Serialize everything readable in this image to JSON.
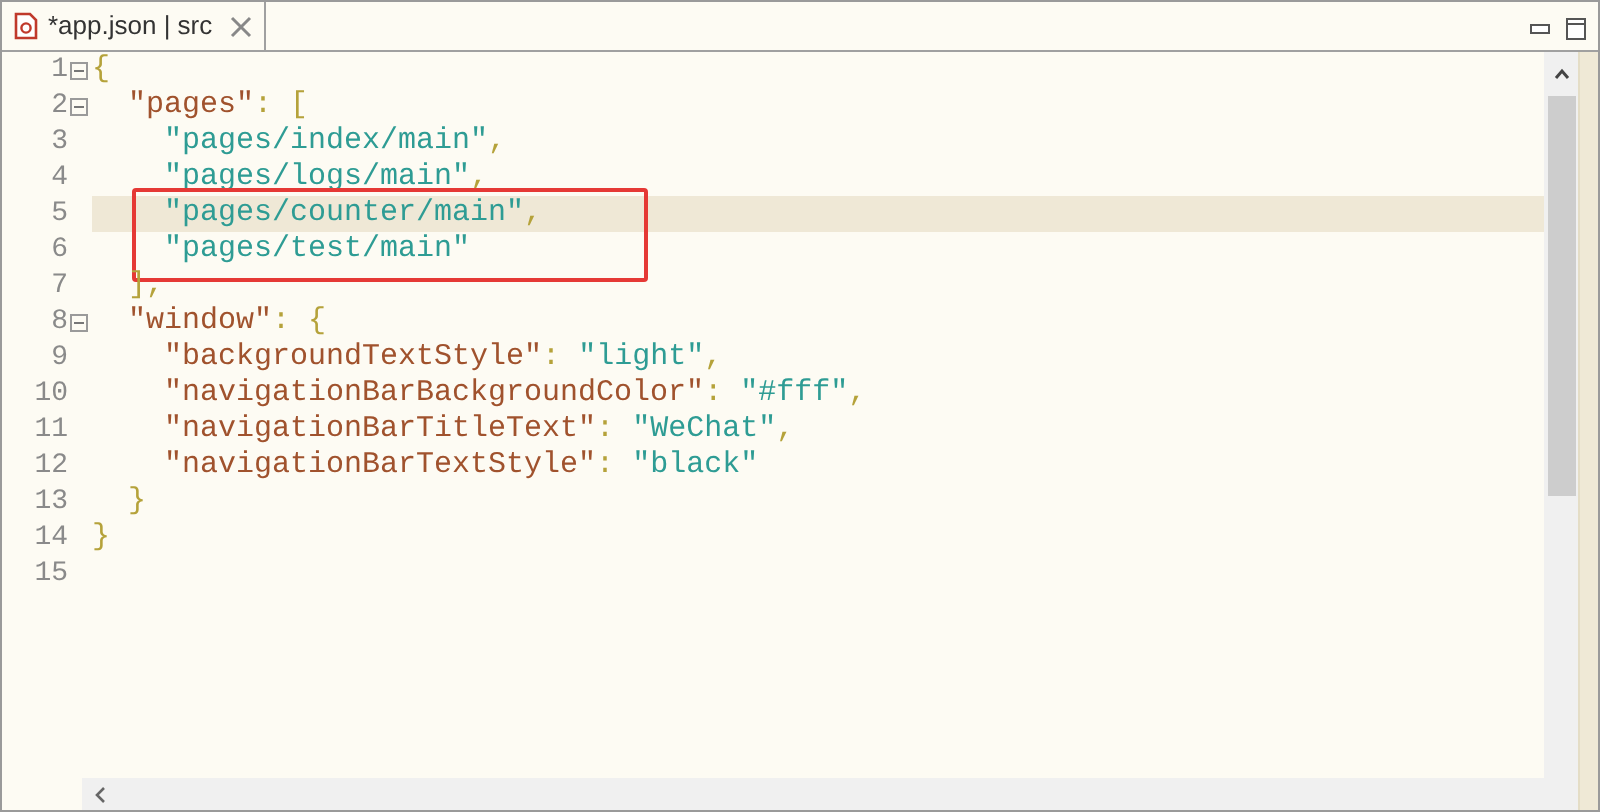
{
  "tab": {
    "title": "*app.json | src",
    "selected": true
  },
  "lines": [
    {
      "number": "1",
      "fold": true,
      "current": false,
      "boxed": false,
      "tokens": [
        {
          "kind": "punct",
          "text": "{"
        }
      ]
    },
    {
      "number": "2",
      "fold": true,
      "current": false,
      "boxed": false,
      "tokens": [
        {
          "kind": "key",
          "text": "  \"pages\""
        },
        {
          "kind": "punct",
          "text": ": ["
        }
      ]
    },
    {
      "number": "3",
      "fold": false,
      "current": false,
      "boxed": false,
      "tokens": [
        {
          "kind": "string",
          "text": "    \"pages/index/main\""
        },
        {
          "kind": "punct",
          "text": ","
        }
      ]
    },
    {
      "number": "4",
      "fold": false,
      "current": false,
      "boxed": false,
      "tokens": [
        {
          "kind": "string",
          "text": "    \"pages/logs/main\""
        },
        {
          "kind": "punct",
          "text": ","
        }
      ]
    },
    {
      "number": "5",
      "fold": false,
      "current": true,
      "boxed": true,
      "tokens": [
        {
          "kind": "string",
          "text": "    \"pages/counter/main\""
        },
        {
          "kind": "punct",
          "text": ","
        }
      ]
    },
    {
      "number": "6",
      "fold": false,
      "current": false,
      "boxed": true,
      "tokens": [
        {
          "kind": "string",
          "text": "    \"pages/test/main\""
        }
      ]
    },
    {
      "number": "7",
      "fold": false,
      "current": false,
      "boxed": false,
      "tokens": [
        {
          "kind": "punct",
          "text": "  ],"
        }
      ]
    },
    {
      "number": "8",
      "fold": true,
      "current": false,
      "boxed": false,
      "tokens": [
        {
          "kind": "key",
          "text": "  \"window\""
        },
        {
          "kind": "punct",
          "text": ": {"
        }
      ]
    },
    {
      "number": "9",
      "fold": false,
      "current": false,
      "boxed": false,
      "tokens": [
        {
          "kind": "key",
          "text": "    \"backgroundTextStyle\""
        },
        {
          "kind": "punct",
          "text": ": "
        },
        {
          "kind": "string",
          "text": "\"light\""
        },
        {
          "kind": "punct",
          "text": ","
        }
      ]
    },
    {
      "number": "10",
      "fold": false,
      "current": false,
      "boxed": false,
      "tokens": [
        {
          "kind": "key",
          "text": "    \"navigationBarBackgroundColor\""
        },
        {
          "kind": "punct",
          "text": ": "
        },
        {
          "kind": "string",
          "text": "\"#fff\""
        },
        {
          "kind": "punct",
          "text": ","
        }
      ]
    },
    {
      "number": "11",
      "fold": false,
      "current": false,
      "boxed": false,
      "tokens": [
        {
          "kind": "key",
          "text": "    \"navigationBarTitleText\""
        },
        {
          "kind": "punct",
          "text": ": "
        },
        {
          "kind": "string",
          "text": "\"WeChat\""
        },
        {
          "kind": "punct",
          "text": ","
        }
      ]
    },
    {
      "number": "12",
      "fold": false,
      "current": false,
      "boxed": false,
      "tokens": [
        {
          "kind": "key",
          "text": "    \"navigationBarTextStyle\""
        },
        {
          "kind": "punct",
          "text": ": "
        },
        {
          "kind": "string",
          "text": "\"black\""
        }
      ]
    },
    {
      "number": "13",
      "fold": false,
      "current": false,
      "boxed": false,
      "tokens": [
        {
          "kind": "punct",
          "text": "  }"
        }
      ]
    },
    {
      "number": "14",
      "fold": false,
      "current": false,
      "boxed": false,
      "tokens": [
        {
          "kind": "punct",
          "text": "}"
        }
      ]
    },
    {
      "number": "15",
      "fold": false,
      "current": false,
      "boxed": false
    }
  ]
}
